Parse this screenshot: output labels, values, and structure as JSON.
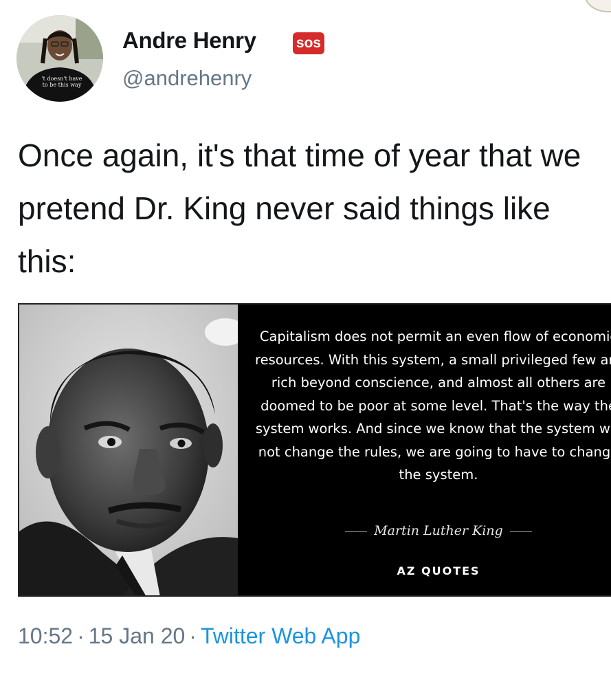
{
  "author": {
    "name": "Andre Henry",
    "badge": "SOS",
    "handle": "@andrehenry",
    "avatar_shirt_text": "'t doesn't have to be this way"
  },
  "tweet": {
    "text": "Once again, it's that time of year that we pretend Dr. King never said things like this:"
  },
  "quote_card": {
    "quote": "Capitalism does not permit an even flow of economic resources. With this system, a small privileged few are rich beyond conscience, and almost all others are doomed to be poor at some level. That's the way the system works. And since we know that the system will not change the rules, we are going to have to change the system.",
    "author": "Martin Luther King",
    "brand": "AZ QUOTES"
  },
  "meta": {
    "time": "10:52",
    "separator": "·",
    "date": "15 Jan 20",
    "source": "Twitter Web App"
  },
  "colors": {
    "text": "#14171a",
    "secondary": "#657786",
    "link": "#1b95e0",
    "badge": "#d62b2b"
  }
}
